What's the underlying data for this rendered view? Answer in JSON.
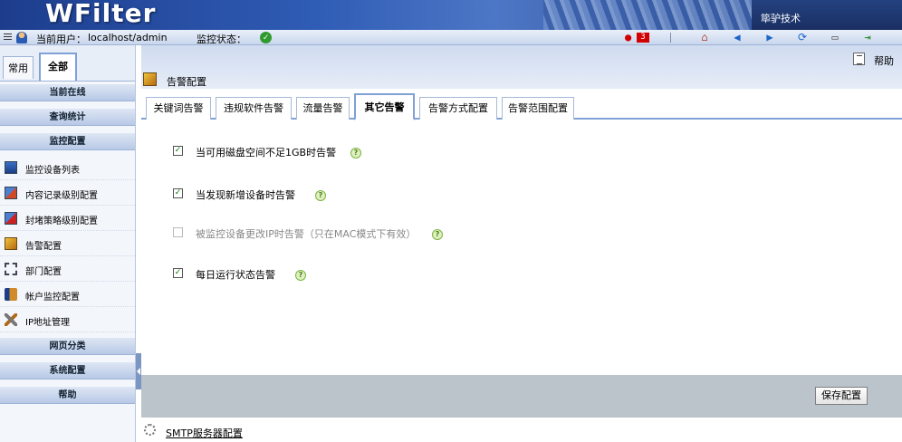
{
  "banner": {
    "logo": "WFilter",
    "company": "筚驴技术"
  },
  "statusbar": {
    "current_user_label": "当前用户：",
    "current_user_value": "localhost/admin",
    "monitor_status_label": "监控状态：",
    "alarm_count": "3",
    "status_ok_color": "#2f9a2f",
    "alarm_color": "#d20000"
  },
  "sidebar": {
    "tabs": [
      {
        "label": "常用",
        "active": false
      },
      {
        "label": "全部",
        "active": true
      }
    ],
    "sections": {
      "online": "当前在线",
      "stats": "查询统计",
      "monitor": "监控配置",
      "web": "网页分类",
      "system": "系统配置",
      "help": "帮助"
    },
    "items": [
      {
        "label": "监控设备列表",
        "icon": "monitor-list-icon"
      },
      {
        "label": "内容记录级别配置",
        "icon": "record-level-icon"
      },
      {
        "label": "封堵策略级别配置",
        "icon": "block-policy-icon"
      },
      {
        "label": "告警配置",
        "icon": "alert-config-icon"
      },
      {
        "label": "部门配置",
        "icon": "department-icon"
      },
      {
        "label": "帐户监控配置",
        "icon": "account-monitor-icon"
      },
      {
        "label": "IP地址管理",
        "icon": "ip-management-icon"
      }
    ]
  },
  "main": {
    "help_label": "帮助",
    "page_title": "告警配置",
    "tabs": [
      {
        "label": "关键词告警",
        "active": false
      },
      {
        "label": "违规软件告警",
        "active": false
      },
      {
        "label": "流量告警",
        "active": false
      },
      {
        "label": "其它告警",
        "active": true
      },
      {
        "label": "告警方式配置",
        "active": false
      },
      {
        "label": "告警范围配置",
        "active": false
      }
    ],
    "options": [
      {
        "label": "当可用磁盘空间不足1GB时告警",
        "checked": true,
        "enabled": true
      },
      {
        "label": "当发现新增设备时告警",
        "checked": true,
        "enabled": true
      },
      {
        "label": "被监控设备更改IP时告警（只在MAC模式下有效）",
        "checked": false,
        "enabled": false
      },
      {
        "label": "每日运行状态告警",
        "checked": true,
        "enabled": true
      }
    ],
    "save_label": "保存配置",
    "smtp_link": "SMTP服务器配置"
  }
}
